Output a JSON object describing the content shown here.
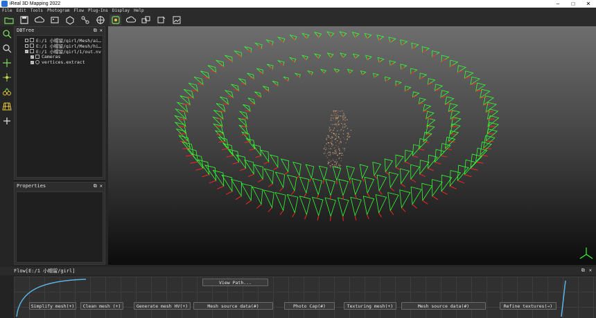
{
  "app": {
    "title": "iReal 3D Mapping 2022"
  },
  "menu": [
    "File",
    "Edit",
    "Tools",
    "Photogram",
    "Flow",
    "Plug-Ins",
    "Display",
    "Help"
  ],
  "toolbar": {
    "icons": [
      "open-folder-icon",
      "save-icon",
      "cloud-icon",
      "screenshot-icon",
      "mesh-model-icon",
      "flow-icon",
      "target-icon",
      "cloud-outline-icon",
      "transform-icon",
      "cube-edit-icon",
      "image-export-icon",
      "settings-image-icon"
    ]
  },
  "lefttools": [
    "zoom-icon",
    "zoom-area-icon",
    "move-axis-icon",
    "pivot-icon",
    "segment-icon",
    "grid-icon",
    "pick-icon"
  ],
  "dbtree": {
    "title": "DBTree",
    "items": [
      {
        "label": "E:/1 小帽留/girl/Mesh/ai…",
        "checked": false
      },
      {
        "label": "E:/1 小帽留/girl/Mesh/hi…",
        "checked": false
      },
      {
        "label": "E:/1 小帽留/girl/1/out.nvm",
        "checked": true
      },
      {
        "label": "Cameras",
        "checked": true
      },
      {
        "label": "vertices.extract",
        "checked": true
      }
    ]
  },
  "properties": {
    "title": "Properties"
  },
  "flow": {
    "title": "Flow[E:/1 小帽留/girl]",
    "buttons": {
      "view_path": "View Path...",
      "simplify": "Simplify mesh(+)",
      "clean": "Clean mesh (+)",
      "generate": "Generate mesh HV(+)",
      "mesh_source_1": "Mesh source data(#)",
      "photo_cap": "Photo Cap(#)",
      "texturing": "Texturing mesh(+)",
      "mesh_source_2": "Mesh source data(#)",
      "refine": "Refine textures(→)"
    }
  },
  "colors": {
    "camera": "#33ff33",
    "accent": "#ff2222"
  }
}
